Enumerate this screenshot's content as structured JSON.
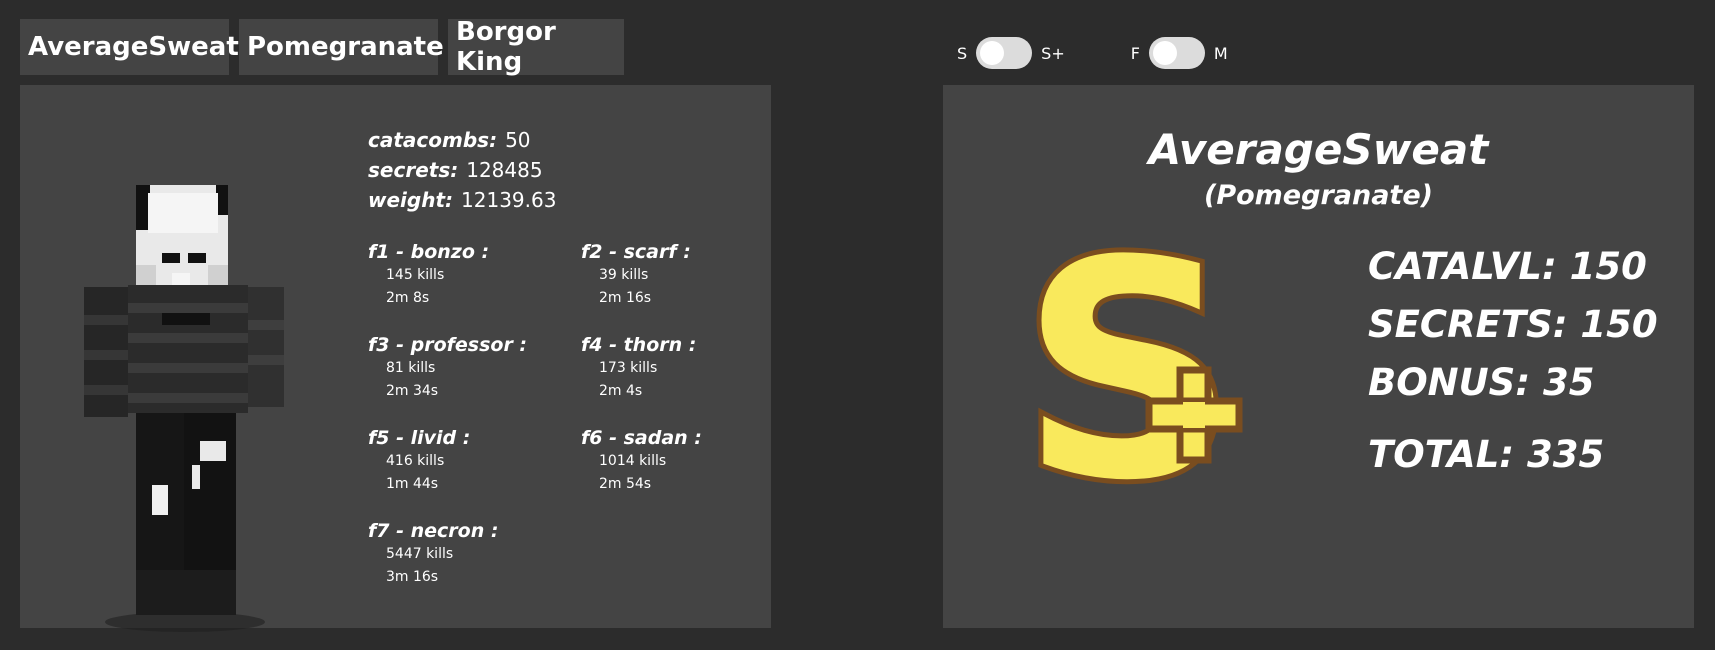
{
  "tabs": [
    "AverageSweat",
    "Pomegranate",
    "Borgor King"
  ],
  "toggles": {
    "rank": {
      "left": "S",
      "right": "S+"
    },
    "mode": {
      "left": "F",
      "right": "M"
    }
  },
  "summary": [
    {
      "key": "catacombs:",
      "value": "50"
    },
    {
      "key": "secrets:",
      "value": "128485"
    },
    {
      "key": "weight:",
      "value": "12139.63"
    }
  ],
  "floors": [
    {
      "title": "f1 - bonzo :",
      "kills": "145 kills",
      "time": "2m 8s"
    },
    {
      "title": "f2 - scarf :",
      "kills": "39 kills",
      "time": "2m 16s"
    },
    {
      "title": "f3 - professor :",
      "kills": "81 kills",
      "time": "2m 34s"
    },
    {
      "title": "f4 - thorn :",
      "kills": "173 kills",
      "time": "2m 4s"
    },
    {
      "title": "f5 - livid :",
      "kills": "416 kills",
      "time": "1m 44s"
    },
    {
      "title": "f6 - sadan :",
      "kills": "1014 kills",
      "time": "2m 54s"
    },
    {
      "title": "f7 - necron :",
      "kills": "5447 kills",
      "time": "3m 16s"
    }
  ],
  "result": {
    "name": "AverageSweat",
    "profile": "(Pomegranate)",
    "grade": "S+",
    "catalvl": "CATALVL: 150",
    "secrets": "SECRETS: 150",
    "bonus": "BONUS: 35",
    "total": "TOTAL: 335"
  },
  "colors": {
    "background": "#2c2c2c",
    "panel": "#444444",
    "grade_fill": "#f9e95c",
    "grade_outline": "#7a4d1f",
    "grade_shade": "#d9a63a"
  }
}
